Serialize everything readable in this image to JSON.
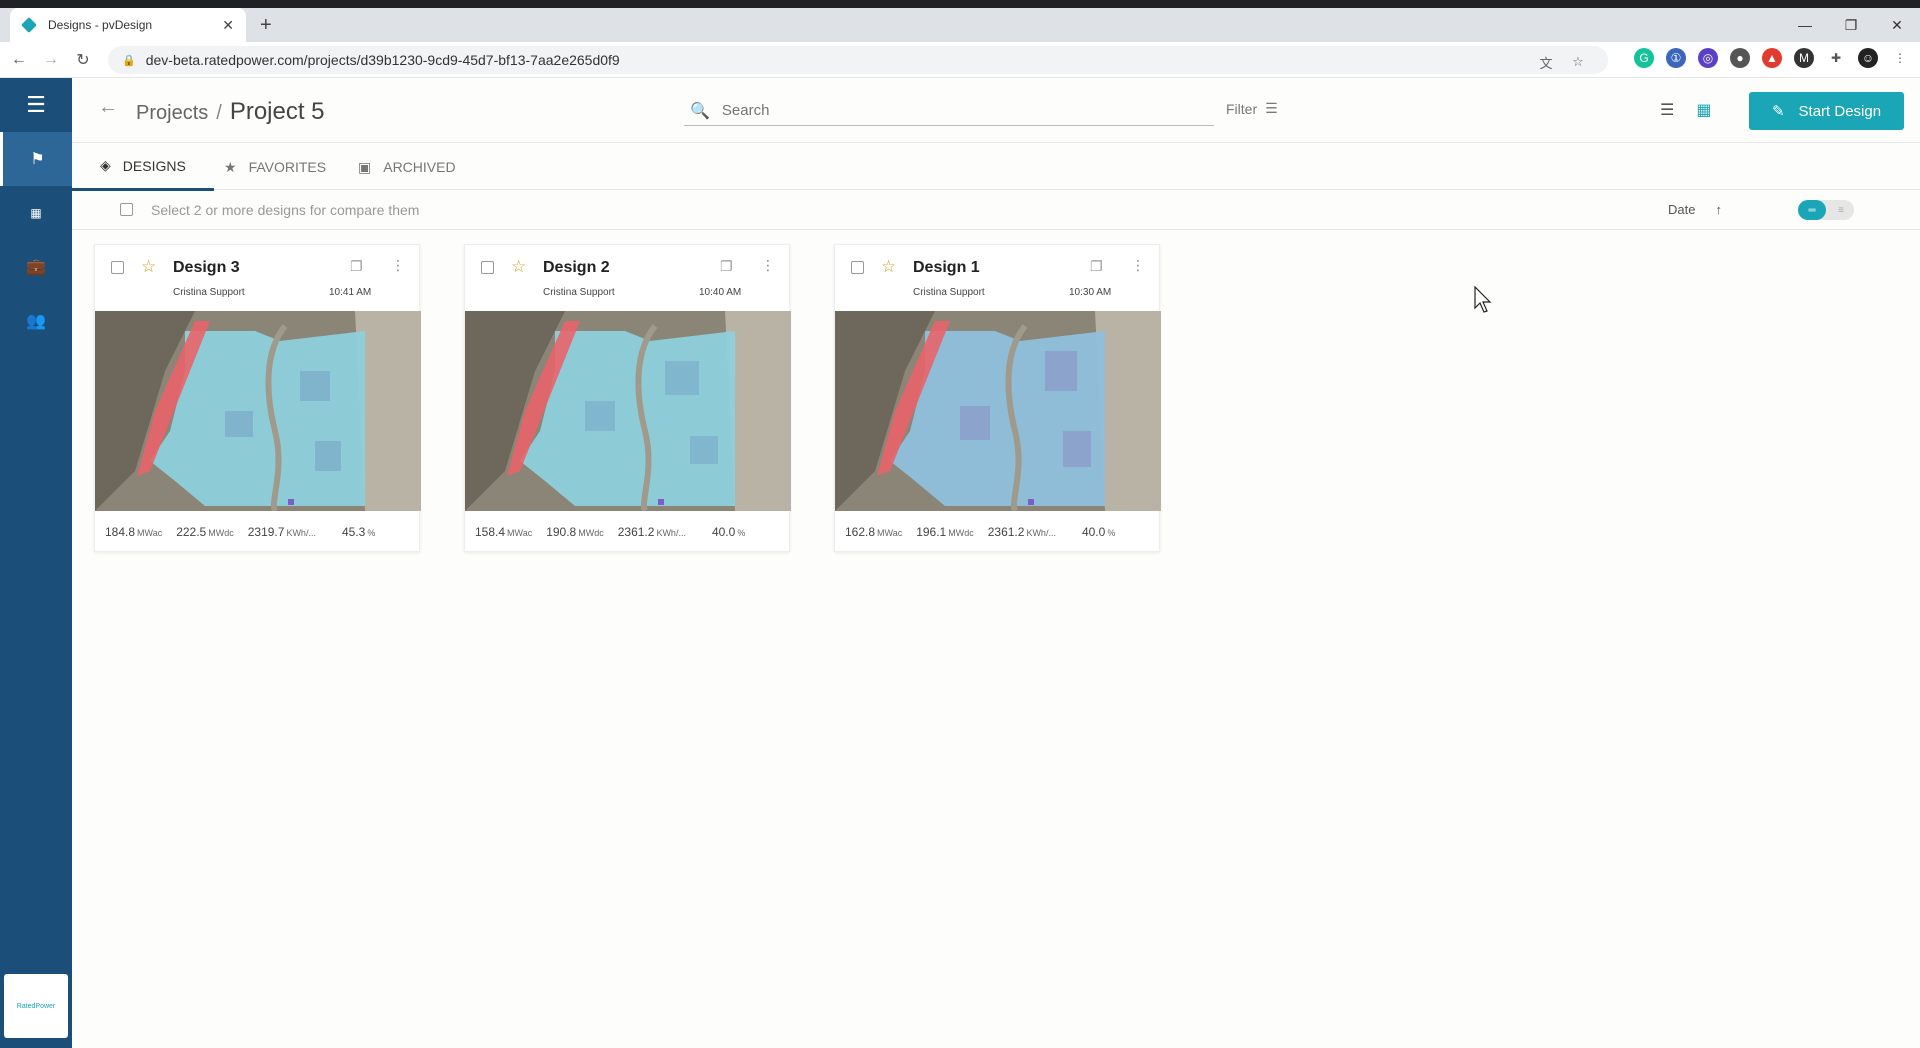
{
  "browser": {
    "tab_title": "Designs - pvDesign",
    "url": "dev-beta.ratedpower.com/projects/d39b1230-9cd9-45d7-bf13-7aa2e265d0f9"
  },
  "header": {
    "breadcrumb_root": "Projects",
    "breadcrumb_sep": "/",
    "project_name": "Project 5",
    "search_placeholder": "Search",
    "filter_label": "Filter",
    "start_button": "Start Design"
  },
  "tabs": [
    {
      "label": "DESIGNS",
      "active": true
    },
    {
      "label": "FAVORITES",
      "active": false
    },
    {
      "label": "ARCHIVED",
      "active": false
    }
  ],
  "compare": {
    "label": "Select 2 or more designs for compare them",
    "sort_label": "Date",
    "sort_arrow": "↑"
  },
  "sidebar": {
    "logo_text": "RatedPower"
  },
  "designs": [
    {
      "name": "Design 3",
      "author": "Cristina Support",
      "time": "10:41 AM",
      "stats": [
        {
          "value": "184.8",
          "unit": "MWac"
        },
        {
          "value": "222.5",
          "unit": "MWdc"
        },
        {
          "value": "2319.7",
          "unit": "KWh/..."
        },
        {
          "value": "45.3",
          "unit": "%"
        }
      ]
    },
    {
      "name": "Design 2",
      "author": "Cristina Support",
      "time": "10:40 AM",
      "stats": [
        {
          "value": "158.4",
          "unit": "MWac"
        },
        {
          "value": "190.8",
          "unit": "MWdc"
        },
        {
          "value": "2361.2",
          "unit": "KWh/..."
        },
        {
          "value": "40.0",
          "unit": "%"
        }
      ]
    },
    {
      "name": "Design 1",
      "author": "Cristina Support",
      "time": "10:30 AM",
      "stats": [
        {
          "value": "162.8",
          "unit": "MWac"
        },
        {
          "value": "196.1",
          "unit": "MWdc"
        },
        {
          "value": "2361.2",
          "unit": "KWh/..."
        },
        {
          "value": "40.0",
          "unit": "%"
        }
      ]
    }
  ],
  "colors": {
    "sidebar": "#1b4f7a",
    "accent": "#1aa6b7",
    "star": "#d4a017"
  }
}
